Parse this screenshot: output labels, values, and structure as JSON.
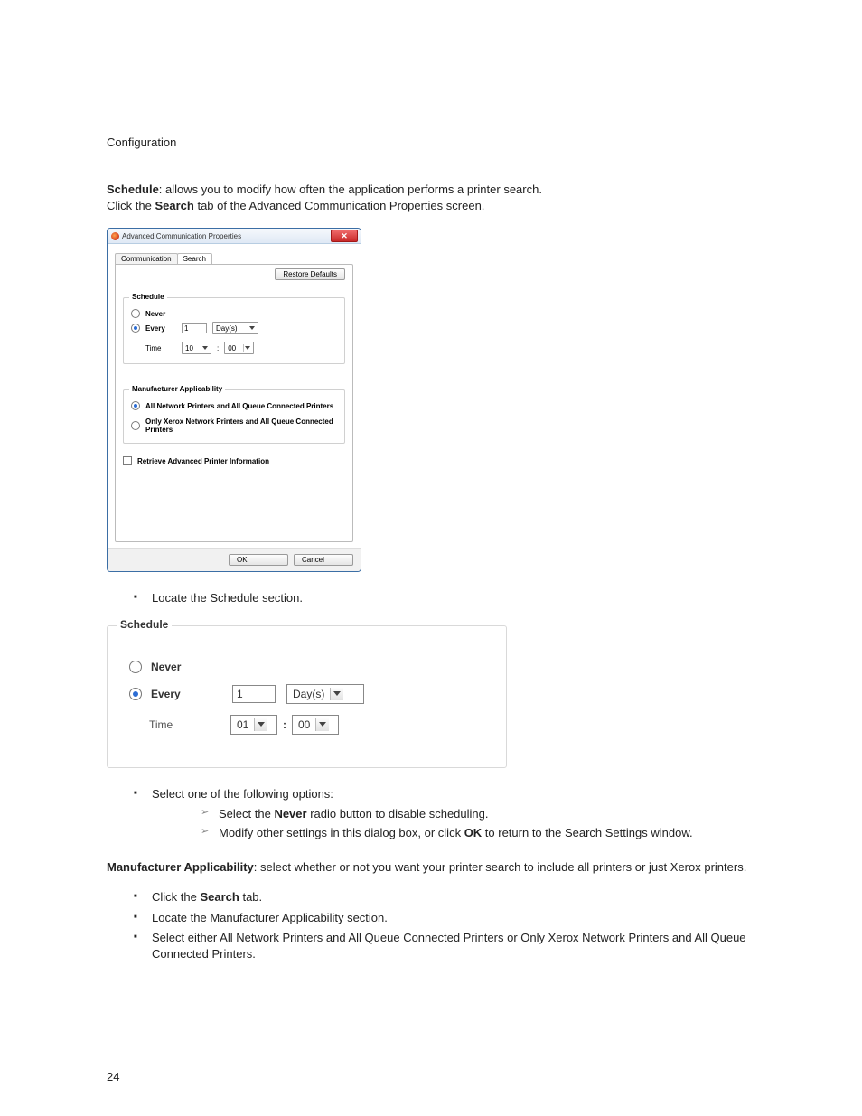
{
  "doc": {
    "section_title": "Configuration",
    "intro_bold": "Schedule",
    "intro_rest": ": allows you to modify how often the application performs a printer search.",
    "intro_line2_a": "Click the ",
    "intro_line2_bold": "Search",
    "intro_line2_b": " tab of the Advanced Communication Properties screen.",
    "page_number": "24"
  },
  "dialog": {
    "title": "Advanced Communication Properties",
    "tabs": {
      "communication": "Communication",
      "search": "Search"
    },
    "restore_defaults": "Restore Defaults",
    "schedule": {
      "legend": "Schedule",
      "never": "Never",
      "every": "Every",
      "every_value": "1",
      "every_unit": "Day(s)",
      "time_label": "Time",
      "time_hour": "10",
      "time_minute": "00",
      "time_sep": ":"
    },
    "mfg": {
      "legend": "Manufacturer Applicability",
      "opt1": "All Network Printers and All Queue Connected Printers",
      "opt2": "Only Xerox Network Printers and All Queue Connected Printers"
    },
    "retrieve": "Retrieve Advanced Printer Information",
    "ok": "OK",
    "cancel": "Cancel"
  },
  "zoom": {
    "legend": "Schedule",
    "never": "Never",
    "every": "Every",
    "every_value": "1",
    "every_unit": "Day(s)",
    "time_label": "Time",
    "hour": "01",
    "minute": "00"
  },
  "list1": {
    "item1": "Locate the Schedule section."
  },
  "list2": {
    "header": "Select one of the following options:",
    "sub1_a": "Select the ",
    "sub1_bold": "Never",
    "sub1_b": " radio button to disable scheduling.",
    "sub2_a": "Modify other settings in this dialog box, or click ",
    "sub2_bold": "OK",
    "sub2_b": " to return to the Search Settings window."
  },
  "mfg_para": {
    "bold": "Manufacturer Applicability",
    "rest": ": select whether or not you want your printer search to include all printers or just Xerox printers."
  },
  "list3": {
    "i1_a": "Click the ",
    "i1_bold": "Search",
    "i1_b": " tab.",
    "i2": "Locate the Manufacturer Applicability section.",
    "i3": "Select either All Network Printers and All Queue Connected Printers or Only Xerox Network Printers and All Queue Connected Printers."
  }
}
